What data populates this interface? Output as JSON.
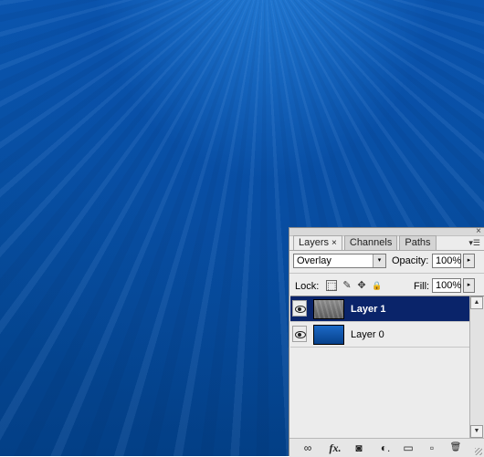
{
  "panel": {
    "tabs": [
      {
        "label": "Layers",
        "close": "×"
      },
      {
        "label": "Channels"
      },
      {
        "label": "Paths"
      }
    ],
    "close_glyph": "×",
    "menu_glyph": "▾☰",
    "blend_mode": "Overlay",
    "opacity_label": "Opacity:",
    "opacity_value": "100%",
    "lock_label": "Lock:",
    "fill_label": "Fill:",
    "fill_value": "100%",
    "arrow_right": "▸",
    "arrow_down": "▾",
    "scroll_up": "▲",
    "scroll_down": "▼"
  },
  "layers": [
    {
      "name": "Layer 1",
      "visible": true,
      "selected": true
    },
    {
      "name": "Layer 0",
      "visible": true,
      "selected": false
    }
  ],
  "lock_icons": [
    "lock-transparent-icon",
    "lock-image-icon",
    "lock-position-icon",
    "lock-all-icon"
  ],
  "lock_glyphs": {
    "transparent": "⬚",
    "image": "✎",
    "position": "✥",
    "all": "🔒"
  },
  "bottom_glyphs": {
    "link": "∞",
    "fx": "fx.",
    "mask": "◙",
    "adjust": "◐.",
    "group": "▭",
    "new": "▫",
    "delete": "🗑"
  },
  "colors": {
    "selection": "#0a246a",
    "canvas": "#064c9c"
  }
}
